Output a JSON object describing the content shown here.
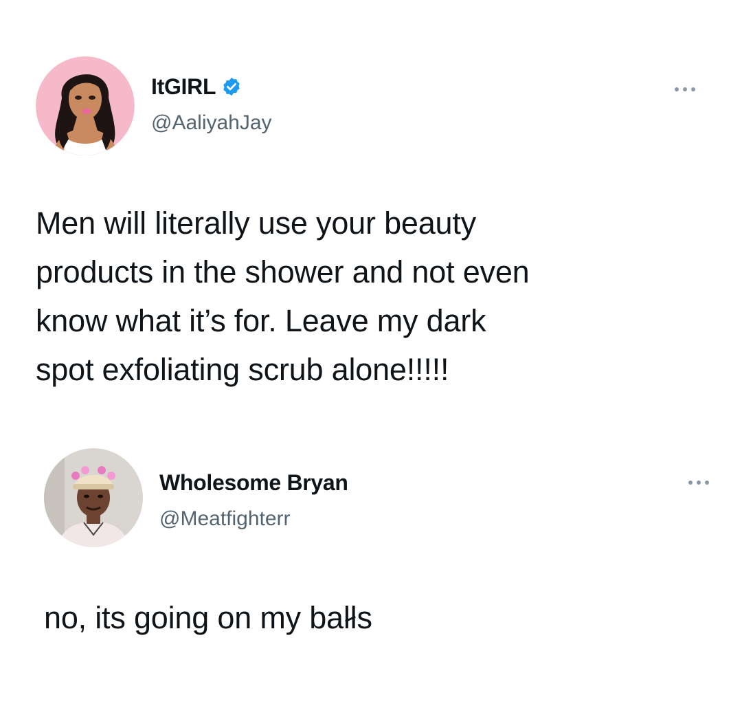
{
  "tweets": [
    {
      "display_name": "ItGIRL",
      "verified": true,
      "handle": "@AaliyahJay",
      "text": "Men will literally use your beauty\nproducts in the shower and not even\nknow what it’s for. Leave my dark\nspot exfoliating scrub alone!!!!!",
      "more_icon": "more-dots-icon"
    },
    {
      "display_name": "Wholesome Bryan",
      "verified": false,
      "handle": "@Meatfighterr",
      "text_before": "no, its going on my ba",
      "text_censored": "ll",
      "text_after": "s",
      "more_icon": "more-dots-icon"
    }
  ],
  "colors": {
    "text_primary": "#0f1419",
    "text_secondary": "#536471",
    "verified_blue": "#1d9bf0",
    "background": "#ffffff"
  }
}
